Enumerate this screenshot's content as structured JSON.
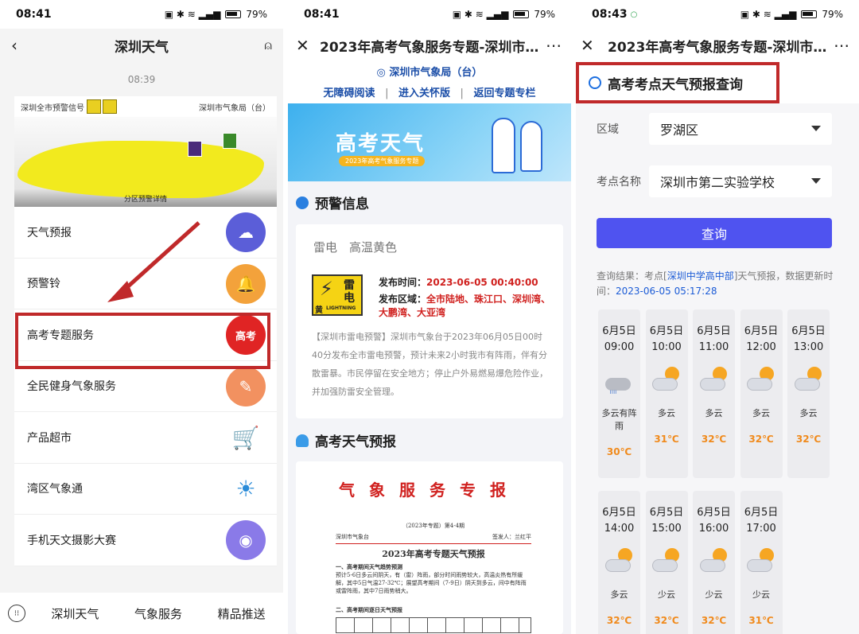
{
  "status": {
    "p1_time": "08:41",
    "p2_time": "08:41",
    "p3_time": "08:43",
    "battery": "79%"
  },
  "p1": {
    "title": "深圳天气",
    "chat_time": "08:39",
    "warn_label": "深圳全市预警信号",
    "org": "深圳市气象局（台）",
    "map_caption": "分区预警详情",
    "menu": [
      {
        "label": "天气预报",
        "color": "#5b5ed8",
        "icon": "cloud-rain-icon",
        "glyph": "☁"
      },
      {
        "label": "预警铃",
        "color": "#f3a23b",
        "icon": "bell-icon",
        "glyph": "🔔"
      },
      {
        "label": "高考专题服务",
        "color": "#e02424",
        "icon": "gaokao-icon",
        "glyph": "高考"
      },
      {
        "label": "全民健身气象服务",
        "color": "#f29160",
        "icon": "fitness-icon",
        "glyph": "✎"
      },
      {
        "label": "产品超市",
        "color": "#ffffff",
        "icon": "shopping-cart-icon",
        "glyph": "🛒"
      },
      {
        "label": "湾区气象通",
        "color": "#ffffff",
        "icon": "bay-area-icon",
        "glyph": "☀"
      },
      {
        "label": "手机天文摄影大赛",
        "color": "#8a7ae8",
        "icon": "camera-icon",
        "glyph": "◉"
      }
    ],
    "tabs": [
      "深圳天气",
      "气象服务",
      "精品推送"
    ]
  },
  "p2": {
    "title": "2023年高考气象服务专题-深圳市...",
    "org": "深圳市气象局（台）",
    "links": [
      "无障碍阅读",
      "进入关怀版",
      "返回专题专栏"
    ],
    "banner_title": "高考天气",
    "banner_sub": "2023年高考气象服务专题",
    "sec1": "预警信息",
    "warn_title": "雷电　高温黄色",
    "sign": {
      "c1": "雷",
      "c2": "电",
      "c3": "黄",
      "c4": "LIGHTNING"
    },
    "pub_label": "发布时间：",
    "pub_time": "2023-06-05 00:40:00",
    "area_label": "发布区域：",
    "area": "全市陆地、珠江口、深圳湾、大鹏湾、大亚湾",
    "body": "【深圳市雷电预警】深圳市气象台于2023年06月05日00时40分发布全市雷电预警，预计未来2小时我市有阵雨，伴有分散雷暴。市民停留在安全地方；停止户外易燃易爆危险作业，并加强防雷安全管理。",
    "sec2": "高考天气预报",
    "doc_title": "气象服务专报",
    "doc_issue": "（2023年专题）第4-4期",
    "doc_from": "深圳市气象台",
    "doc_signer": "签发人：兰红平",
    "doc_heading": "2023年高考专题天气预报",
    "doc_s1": "一、高考期间天气趋势预测",
    "doc_p1": "预计5-6日多云间阴天，有（雷）阵雨，部分时间雨势较大，高温炎热有所缓解，其中5日气温27-32℃；展望高考期间（7-9日）阴天到多云，间中有阵雨或雷阵雨，其中7日雨势稍大。",
    "doc_s2": "二、高考期间逐日天气预报"
  },
  "p3": {
    "title": "2023年高考气象服务专题-深圳市...",
    "head": "高考考点天气预报查询",
    "region_label": "区域",
    "region_value": "罗湖区",
    "site_label": "考点名称",
    "site_value": "深圳市第二实验学校",
    "query_button": "查询",
    "result_prefix": "查询结果：考点[",
    "result_site": "深圳中学高中部",
    "result_suffix": "]天气预报，数据更新时间：",
    "result_time": "2023-06-05 05:17:28",
    "forecast": [
      {
        "date": "6月5日",
        "time": "09:00",
        "weather": "多云有阵雨",
        "temp": "30℃"
      },
      {
        "date": "6月5日",
        "time": "10:00",
        "weather": "多云",
        "temp": "31℃"
      },
      {
        "date": "6月5日",
        "time": "11:00",
        "weather": "多云",
        "temp": "32℃"
      },
      {
        "date": "6月5日",
        "time": "12:00",
        "weather": "多云",
        "temp": "32℃"
      },
      {
        "date": "6月5日",
        "time": "13:00",
        "weather": "多云",
        "temp": "32℃"
      },
      {
        "date": "6月5日",
        "time": "14:00",
        "weather": "多云",
        "temp": "32℃"
      },
      {
        "date": "6月5日",
        "time": "15:00",
        "weather": "少云",
        "temp": "32℃"
      },
      {
        "date": "6月5日",
        "time": "16:00",
        "weather": "少云",
        "temp": "32℃"
      },
      {
        "date": "6月5日",
        "time": "17:00",
        "weather": "少云",
        "temp": "31℃"
      }
    ]
  }
}
